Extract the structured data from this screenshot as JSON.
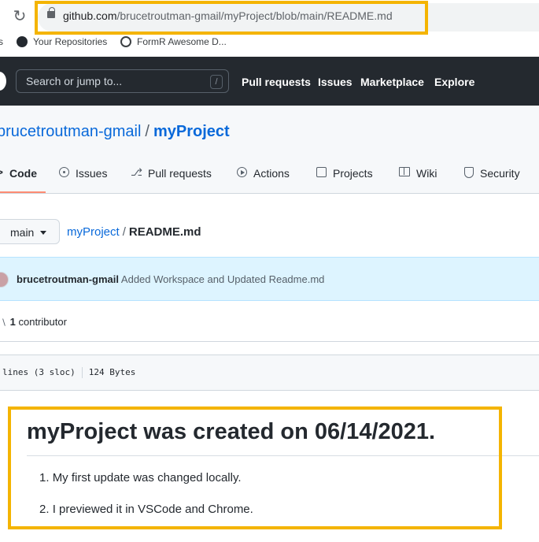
{
  "browser": {
    "url_host": "github.com",
    "url_path": "/brucetroutman-gmail/myProject/blob/main/README.md",
    "bookmarks": [
      {
        "label": "s"
      },
      {
        "label": "Your Repositories"
      },
      {
        "label": "FormR Awesome D..."
      }
    ]
  },
  "header": {
    "search_placeholder": "Search or jump to...",
    "search_shortcut": "/",
    "nav": [
      "Pull requests",
      "Issues",
      "Marketplace",
      "Explore"
    ]
  },
  "repo": {
    "owner": "brucetroutman-gmail",
    "separator": "/",
    "name": "myProject"
  },
  "tabs": [
    {
      "label": "Code",
      "active": true
    },
    {
      "label": "Issues"
    },
    {
      "label": "Pull requests"
    },
    {
      "label": "Actions"
    },
    {
      "label": "Projects"
    },
    {
      "label": "Wiki"
    },
    {
      "label": "Security"
    }
  ],
  "breadcrumb": {
    "branch": "main",
    "repo": "myProject",
    "separator": "/",
    "file": "README.md"
  },
  "commit": {
    "author": "brucetroutman-gmail",
    "message": "Added Workspace and Updated Readme.md"
  },
  "contributors": {
    "count": "1",
    "label": "contributor"
  },
  "file_info": {
    "lines": "lines (3 sloc)",
    "size": "124 Bytes"
  },
  "readme": {
    "title": "myProject was created on 06/14/2021.",
    "items": [
      "My first update was changed locally.",
      "I previewed it in VSCode and Chrome."
    ]
  },
  "colors": {
    "highlight": "#f4b400",
    "header_bg": "#24292f",
    "link": "#0969da",
    "tab_underline": "#fd8c73",
    "commit_bg": "#ddf4ff"
  }
}
